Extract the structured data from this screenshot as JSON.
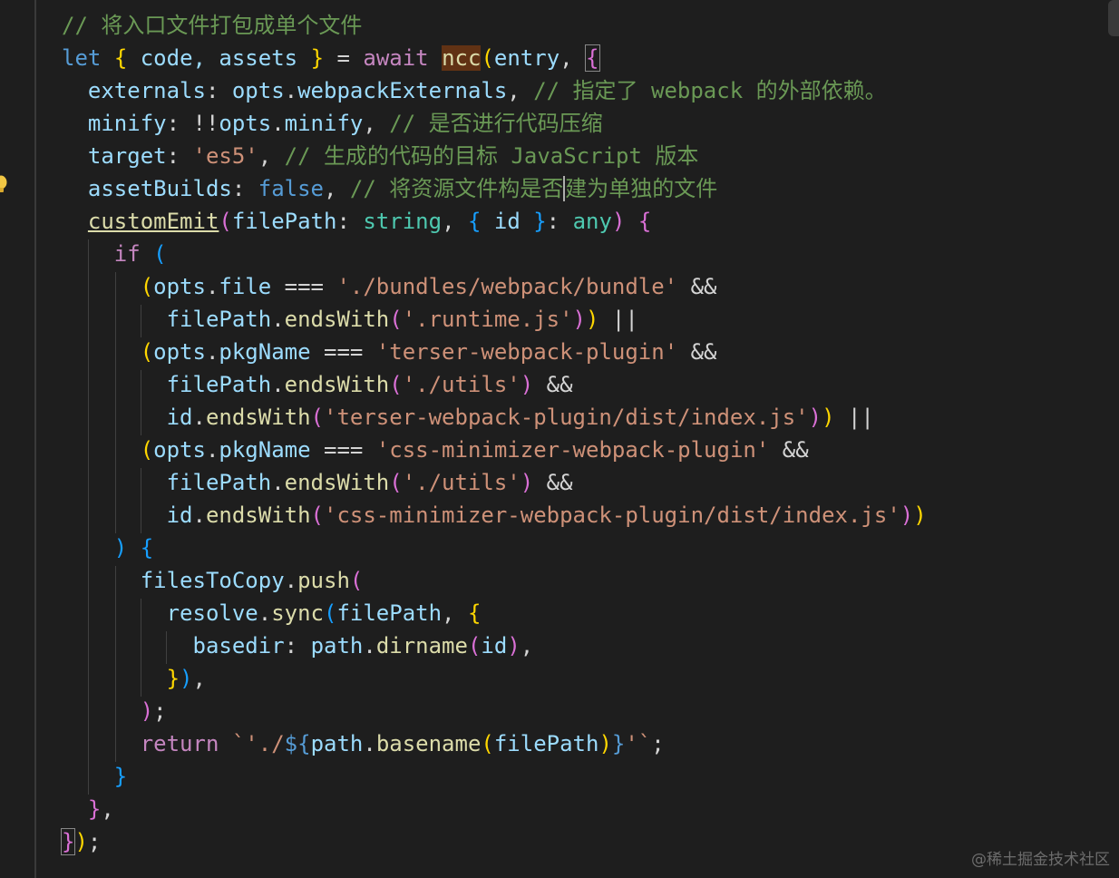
{
  "editor": {
    "language": "typescript",
    "theme": "dark",
    "lines": [
      {
        "tokens": [
          {
            "t": "// 将入口文件打包成单个文件",
            "c": "c"
          }
        ]
      },
      {
        "tokens": [
          {
            "t": "let",
            "c": "k"
          },
          {
            "t": " "
          },
          {
            "t": "{",
            "c": "b1"
          },
          {
            "t": " code, assets ",
            "c": "v"
          },
          {
            "t": "}",
            "c": "b1"
          },
          {
            "t": " = ",
            "c": "p"
          },
          {
            "t": "await",
            "c": "kc"
          },
          {
            "t": " "
          },
          {
            "t": "ncc",
            "c": "f hl"
          },
          {
            "t": "(",
            "c": "b1"
          },
          {
            "t": "entry",
            "c": "v"
          },
          {
            "t": ", ",
            "c": "p"
          },
          {
            "t": "{",
            "c": "b2 box"
          }
        ]
      },
      {
        "tokens": [
          {
            "t": "  externals",
            "c": "v"
          },
          {
            "t": ": ",
            "c": "p"
          },
          {
            "t": "opts",
            "c": "v"
          },
          {
            "t": ".",
            "c": "p"
          },
          {
            "t": "webpackExternals",
            "c": "v"
          },
          {
            "t": ", ",
            "c": "p"
          },
          {
            "t": "// 指定了 webpack 的外部依赖。",
            "c": "c"
          }
        ]
      },
      {
        "tokens": [
          {
            "t": "  minify",
            "c": "v"
          },
          {
            "t": ": !!",
            "c": "p"
          },
          {
            "t": "opts",
            "c": "v"
          },
          {
            "t": ".",
            "c": "p"
          },
          {
            "t": "minify",
            "c": "v"
          },
          {
            "t": ", ",
            "c": "p"
          },
          {
            "t": "// 是否进行代码压缩",
            "c": "c"
          }
        ]
      },
      {
        "tokens": [
          {
            "t": "  target",
            "c": "v"
          },
          {
            "t": ": ",
            "c": "p"
          },
          {
            "t": "'es5'",
            "c": "s"
          },
          {
            "t": ", ",
            "c": "p"
          },
          {
            "t": "// 生成的代码的目标 JavaScript 版本",
            "c": "c"
          }
        ]
      },
      {
        "tokens": [
          {
            "t": "  assetBuilds",
            "c": "v"
          },
          {
            "t": ": ",
            "c": "p"
          },
          {
            "t": "false",
            "c": "k"
          },
          {
            "t": ", ",
            "c": "p"
          },
          {
            "t": "// 将资源文件构是否",
            "c": "c"
          },
          {
            "t": "",
            "c": "cursor"
          },
          {
            "t": "建为单独的文件",
            "c": "c"
          }
        ]
      },
      {
        "tokens": [
          {
            "t": "  "
          },
          {
            "t": "customEmit",
            "c": "f u"
          },
          {
            "t": "(",
            "c": "b2"
          },
          {
            "t": "filePath",
            "c": "v"
          },
          {
            "t": ": ",
            "c": "p"
          },
          {
            "t": "string",
            "c": "t"
          },
          {
            "t": ", ",
            "c": "p"
          },
          {
            "t": "{",
            "c": "b3"
          },
          {
            "t": " id ",
            "c": "v"
          },
          {
            "t": "}",
            "c": "b3"
          },
          {
            "t": ": ",
            "c": "p"
          },
          {
            "t": "any",
            "c": "t"
          },
          {
            "t": ")",
            "c": "b2"
          },
          {
            "t": " "
          },
          {
            "t": "{",
            "c": "b2"
          }
        ]
      },
      {
        "tokens": [
          {
            "t": "    "
          },
          {
            "t": "if",
            "c": "kc"
          },
          {
            "t": " "
          },
          {
            "t": "(",
            "c": "b3"
          }
        ]
      },
      {
        "tokens": [
          {
            "t": "      "
          },
          {
            "t": "(",
            "c": "b1"
          },
          {
            "t": "opts",
            "c": "v"
          },
          {
            "t": ".",
            "c": "p"
          },
          {
            "t": "file",
            "c": "v"
          },
          {
            "t": " === ",
            "c": "p"
          },
          {
            "t": "'./bundles/webpack/bundle'",
            "c": "s"
          },
          {
            "t": " &&",
            "c": "p"
          }
        ]
      },
      {
        "tokens": [
          {
            "t": "        "
          },
          {
            "t": "filePath",
            "c": "v"
          },
          {
            "t": ".",
            "c": "p"
          },
          {
            "t": "endsWith",
            "c": "f"
          },
          {
            "t": "(",
            "c": "b2"
          },
          {
            "t": "'.runtime.js'",
            "c": "s"
          },
          {
            "t": ")",
            "c": "b2"
          },
          {
            "t": ")",
            "c": "b1"
          },
          {
            "t": " ||",
            "c": "p"
          }
        ]
      },
      {
        "tokens": [
          {
            "t": "      "
          },
          {
            "t": "(",
            "c": "b1"
          },
          {
            "t": "opts",
            "c": "v"
          },
          {
            "t": ".",
            "c": "p"
          },
          {
            "t": "pkgName",
            "c": "v"
          },
          {
            "t": " === ",
            "c": "p"
          },
          {
            "t": "'terser-webpack-plugin'",
            "c": "s"
          },
          {
            "t": " &&",
            "c": "p"
          }
        ]
      },
      {
        "tokens": [
          {
            "t": "        "
          },
          {
            "t": "filePath",
            "c": "v"
          },
          {
            "t": ".",
            "c": "p"
          },
          {
            "t": "endsWith",
            "c": "f"
          },
          {
            "t": "(",
            "c": "b2"
          },
          {
            "t": "'./utils'",
            "c": "s"
          },
          {
            "t": ")",
            "c": "b2"
          },
          {
            "t": " &&",
            "c": "p"
          }
        ]
      },
      {
        "tokens": [
          {
            "t": "        "
          },
          {
            "t": "id",
            "c": "v"
          },
          {
            "t": ".",
            "c": "p"
          },
          {
            "t": "endsWith",
            "c": "f"
          },
          {
            "t": "(",
            "c": "b2"
          },
          {
            "t": "'terser-webpack-plugin/dist/index.js'",
            "c": "s"
          },
          {
            "t": ")",
            "c": "b2"
          },
          {
            "t": ")",
            "c": "b1"
          },
          {
            "t": " ||",
            "c": "p"
          }
        ]
      },
      {
        "tokens": [
          {
            "t": "      "
          },
          {
            "t": "(",
            "c": "b1"
          },
          {
            "t": "opts",
            "c": "v"
          },
          {
            "t": ".",
            "c": "p"
          },
          {
            "t": "pkgName",
            "c": "v"
          },
          {
            "t": " === ",
            "c": "p"
          },
          {
            "t": "'css-minimizer-webpack-plugin'",
            "c": "s"
          },
          {
            "t": " &&",
            "c": "p"
          }
        ]
      },
      {
        "tokens": [
          {
            "t": "        "
          },
          {
            "t": "filePath",
            "c": "v"
          },
          {
            "t": ".",
            "c": "p"
          },
          {
            "t": "endsWith",
            "c": "f"
          },
          {
            "t": "(",
            "c": "b2"
          },
          {
            "t": "'./utils'",
            "c": "s"
          },
          {
            "t": ")",
            "c": "b2"
          },
          {
            "t": " &&",
            "c": "p"
          }
        ]
      },
      {
        "tokens": [
          {
            "t": "        "
          },
          {
            "t": "id",
            "c": "v"
          },
          {
            "t": ".",
            "c": "p"
          },
          {
            "t": "endsWith",
            "c": "f"
          },
          {
            "t": "(",
            "c": "b2"
          },
          {
            "t": "'css-minimizer-webpack-plugin/dist/index.js'",
            "c": "s"
          },
          {
            "t": ")",
            "c": "b2"
          },
          {
            "t": ")",
            "c": "b1"
          }
        ]
      },
      {
        "tokens": [
          {
            "t": "    "
          },
          {
            "t": ")",
            "c": "b3"
          },
          {
            "t": " "
          },
          {
            "t": "{",
            "c": "b3"
          }
        ]
      },
      {
        "tokens": [
          {
            "t": "      "
          },
          {
            "t": "filesToCopy",
            "c": "v"
          },
          {
            "t": ".",
            "c": "p"
          },
          {
            "t": "push",
            "c": "f"
          },
          {
            "t": "(",
            "c": "b2"
          }
        ]
      },
      {
        "tokens": [
          {
            "t": "        "
          },
          {
            "t": "resolve",
            "c": "v"
          },
          {
            "t": ".",
            "c": "p"
          },
          {
            "t": "sync",
            "c": "f"
          },
          {
            "t": "(",
            "c": "b3"
          },
          {
            "t": "filePath",
            "c": "v"
          },
          {
            "t": ", ",
            "c": "p"
          },
          {
            "t": "{",
            "c": "b1"
          }
        ]
      },
      {
        "tokens": [
          {
            "t": "          "
          },
          {
            "t": "basedir",
            "c": "v"
          },
          {
            "t": ": ",
            "c": "p"
          },
          {
            "t": "path",
            "c": "v"
          },
          {
            "t": ".",
            "c": "p"
          },
          {
            "t": "dirname",
            "c": "f"
          },
          {
            "t": "(",
            "c": "b2"
          },
          {
            "t": "id",
            "c": "v"
          },
          {
            "t": ")",
            "c": "b2"
          },
          {
            "t": ",",
            "c": "p"
          }
        ]
      },
      {
        "tokens": [
          {
            "t": "        "
          },
          {
            "t": "}",
            "c": "b1"
          },
          {
            "t": ")",
            "c": "b3"
          },
          {
            "t": ",",
            "c": "p"
          }
        ]
      },
      {
        "tokens": [
          {
            "t": "      "
          },
          {
            "t": ")",
            "c": "b2"
          },
          {
            "t": ";",
            "c": "p"
          }
        ]
      },
      {
        "tokens": [
          {
            "t": "      "
          },
          {
            "t": "return",
            "c": "kc"
          },
          {
            "t": " "
          },
          {
            "t": "`'./",
            "c": "s"
          },
          {
            "t": "${",
            "c": "k"
          },
          {
            "t": "path",
            "c": "v"
          },
          {
            "t": ".",
            "c": "p"
          },
          {
            "t": "basename",
            "c": "f"
          },
          {
            "t": "(",
            "c": "b1"
          },
          {
            "t": "filePath",
            "c": "v"
          },
          {
            "t": ")",
            "c": "b1"
          },
          {
            "t": "}",
            "c": "k"
          },
          {
            "t": "'`",
            "c": "s"
          },
          {
            "t": ";",
            "c": "p"
          }
        ]
      },
      {
        "tokens": [
          {
            "t": "    "
          },
          {
            "t": "}",
            "c": "b3"
          }
        ]
      },
      {
        "tokens": [
          {
            "t": "  "
          },
          {
            "t": "}",
            "c": "b2"
          },
          {
            "t": ",",
            "c": "p"
          }
        ]
      },
      {
        "tokens": [
          {
            "t": "}",
            "c": "b2 box"
          },
          {
            "t": ")",
            "c": "b1"
          },
          {
            "t": ";",
            "c": "p"
          }
        ]
      }
    ]
  },
  "icons": {
    "lightbulb": "lightbulb-icon"
  },
  "watermark": "@稀土掘金技术社区",
  "colors": {
    "background": "#1e1e1e",
    "comment": "#6a9955",
    "keyword": "#569cd6",
    "control": "#c586c0",
    "variable": "#9cdcfe",
    "function": "#dcdcaa",
    "string": "#ce9178",
    "type": "#4ec9b0",
    "bracket1": "#ffd700",
    "bracket2": "#da70d6",
    "bracket3": "#179fff"
  }
}
